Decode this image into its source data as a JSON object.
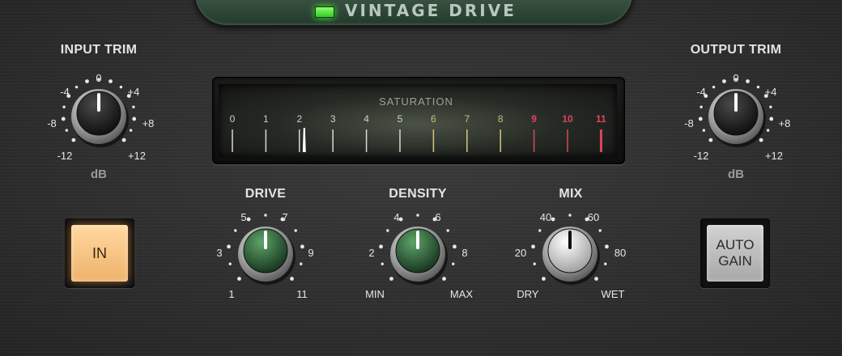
{
  "title": "VINTAGE DRIVE",
  "input_trim": {
    "label": "INPUT TRIM",
    "unit": "dB",
    "scale": [
      "-12",
      "-8",
      "-4",
      "0",
      "+4",
      "+8",
      "+12"
    ],
    "value": "0"
  },
  "output_trim": {
    "label": "OUTPUT TRIM",
    "unit": "dB",
    "scale": [
      "-12",
      "-8",
      "-4",
      "0",
      "+4",
      "+8",
      "+12"
    ],
    "value": "0"
  },
  "meter": {
    "label": "SATURATION",
    "scale": [
      "0",
      "1",
      "2",
      "3",
      "4",
      "5",
      "6",
      "7",
      "8",
      "9",
      "10",
      "11"
    ],
    "needle_value": 2,
    "colors": {
      "normal": "#d8d8d8",
      "mid": "#d7c77a",
      "hot": "#e0445a"
    }
  },
  "drive": {
    "label": "DRIVE",
    "scale": [
      "1",
      "3",
      "5",
      "7",
      "9",
      "11"
    ],
    "value_fraction": 0.5,
    "cap_color": "#2f6a3a"
  },
  "density": {
    "label": "DENSITY",
    "scale": [
      "MIN",
      "2",
      "4",
      "6",
      "8",
      "MAX"
    ],
    "value_fraction": 0.5,
    "cap_color": "#2f6a3a"
  },
  "mix": {
    "label": "MIX",
    "scale": [
      "DRY",
      "20",
      "40",
      "60",
      "80",
      "WET"
    ],
    "value_fraction": 0.5,
    "cap_color": "#e6e6e6"
  },
  "in_button": {
    "label": "IN",
    "active": true
  },
  "auto_gain_button": {
    "label_line1": "AUTO",
    "label_line2": "GAIN",
    "active": false
  }
}
